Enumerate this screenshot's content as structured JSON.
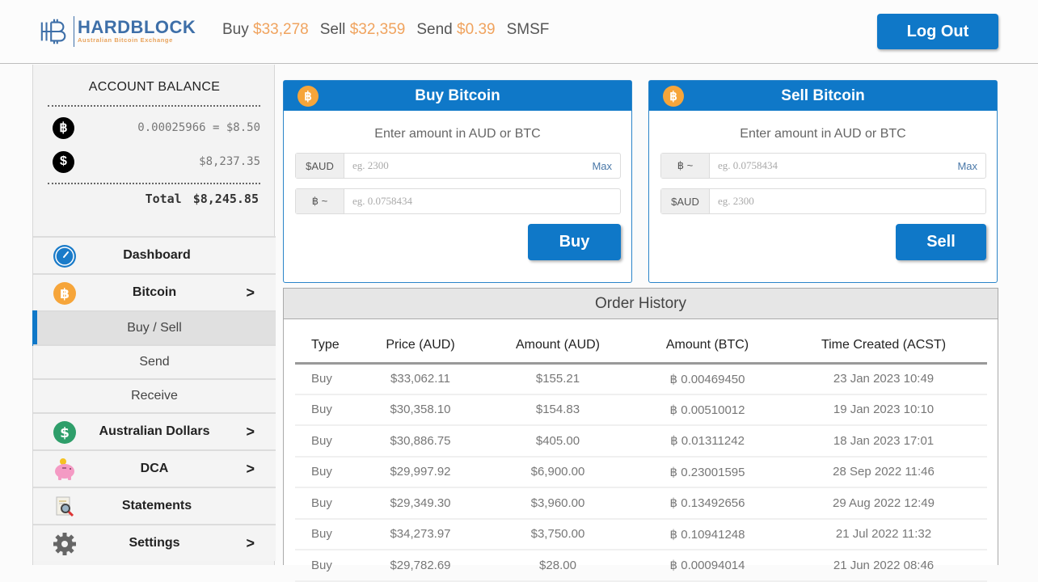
{
  "header": {
    "brand_name": "HARDBLOCK",
    "brand_tagline": "Australian Bitcoin Exchange",
    "ticker": [
      {
        "label": "Buy",
        "price": "$33,278"
      },
      {
        "label": "Sell",
        "price": "$32,359"
      },
      {
        "label": "Send",
        "price": "$0.39"
      }
    ],
    "smsf_label": "SMSF",
    "logout_label": "Log Out"
  },
  "balance": {
    "title": "ACCOUNT BALANCE",
    "btc_icon": "bitcoin-icon",
    "btc_value": "0.00025966 = $8.50",
    "aud_icon": "dollar-icon",
    "aud_value": "$8,237.35",
    "total_label": "Total",
    "total_value": "$8,245.85"
  },
  "nav": {
    "dashboard": {
      "label": "Dashboard",
      "icon": "gauge-icon"
    },
    "bitcoin": {
      "label": "Bitcoin",
      "icon": "bitcoin-icon"
    },
    "buy_sell": {
      "label": "Buy / Sell"
    },
    "send": {
      "label": "Send"
    },
    "receive": {
      "label": "Receive"
    },
    "aud": {
      "label": "Australian Dollars",
      "icon": "dollar-icon"
    },
    "dca": {
      "label": "DCA",
      "icon": "piggy-bank-icon"
    },
    "statements": {
      "label": "Statements",
      "icon": "document-search-icon"
    },
    "settings": {
      "label": "Settings",
      "icon": "gear-icon"
    },
    "chevron": ">"
  },
  "buy_panel": {
    "title": "Buy Bitcoin",
    "badge": "B",
    "subtitle": "Enter amount in AUD or BTC",
    "aud_addon": "$AUD",
    "aud_placeholder": "eg. 2300",
    "max_label": "Max",
    "btc_addon": "฿ ~",
    "btc_placeholder": "eg. 0.0758434",
    "button_label": "Buy"
  },
  "sell_panel": {
    "title": "Sell Bitcoin",
    "badge": "B",
    "subtitle": "Enter amount in AUD or BTC",
    "btc_addon": "฿ ~",
    "btc_placeholder": "eg. 0.0758434",
    "max_label": "Max",
    "aud_addon": "$AUD",
    "aud_placeholder": "eg. 2300",
    "button_label": "Sell"
  },
  "history": {
    "title": "Order History",
    "columns": [
      "Type",
      "Price (AUD)",
      "Amount (AUD)",
      "Amount (BTC)",
      "Time Created (ACST)"
    ],
    "rows": [
      [
        "Buy",
        "$33,062.11",
        "$155.21",
        "฿ 0.00469450",
        "23 Jan 2023 10:49"
      ],
      [
        "Buy",
        "$30,358.10",
        "$154.83",
        "฿ 0.00510012",
        "19 Jan 2023 10:10"
      ],
      [
        "Buy",
        "$30,886.75",
        "$405.00",
        "฿ 0.01311242",
        "18 Jan 2023 17:01"
      ],
      [
        "Buy",
        "$29,997.92",
        "$6,900.00",
        "฿ 0.23001595",
        "28 Sep 2022 11:46"
      ],
      [
        "Buy",
        "$29,349.30",
        "$3,960.00",
        "฿ 0.13492656",
        "29 Aug 2022 12:49"
      ],
      [
        "Buy",
        "$34,273.97",
        "$3,750.00",
        "฿ 0.10941248",
        "21 Jul 2022 11:32"
      ],
      [
        "Buy",
        "$29,782.69",
        "$28.00",
        "฿ 0.00094014",
        "21 Jun 2022 08:46"
      ]
    ]
  },
  "colors": {
    "primary": "#0f78c8",
    "price_accent": "#f0a35e",
    "bitcoin_orange": "#f6a53a",
    "aud_green": "#2e9e6a"
  }
}
